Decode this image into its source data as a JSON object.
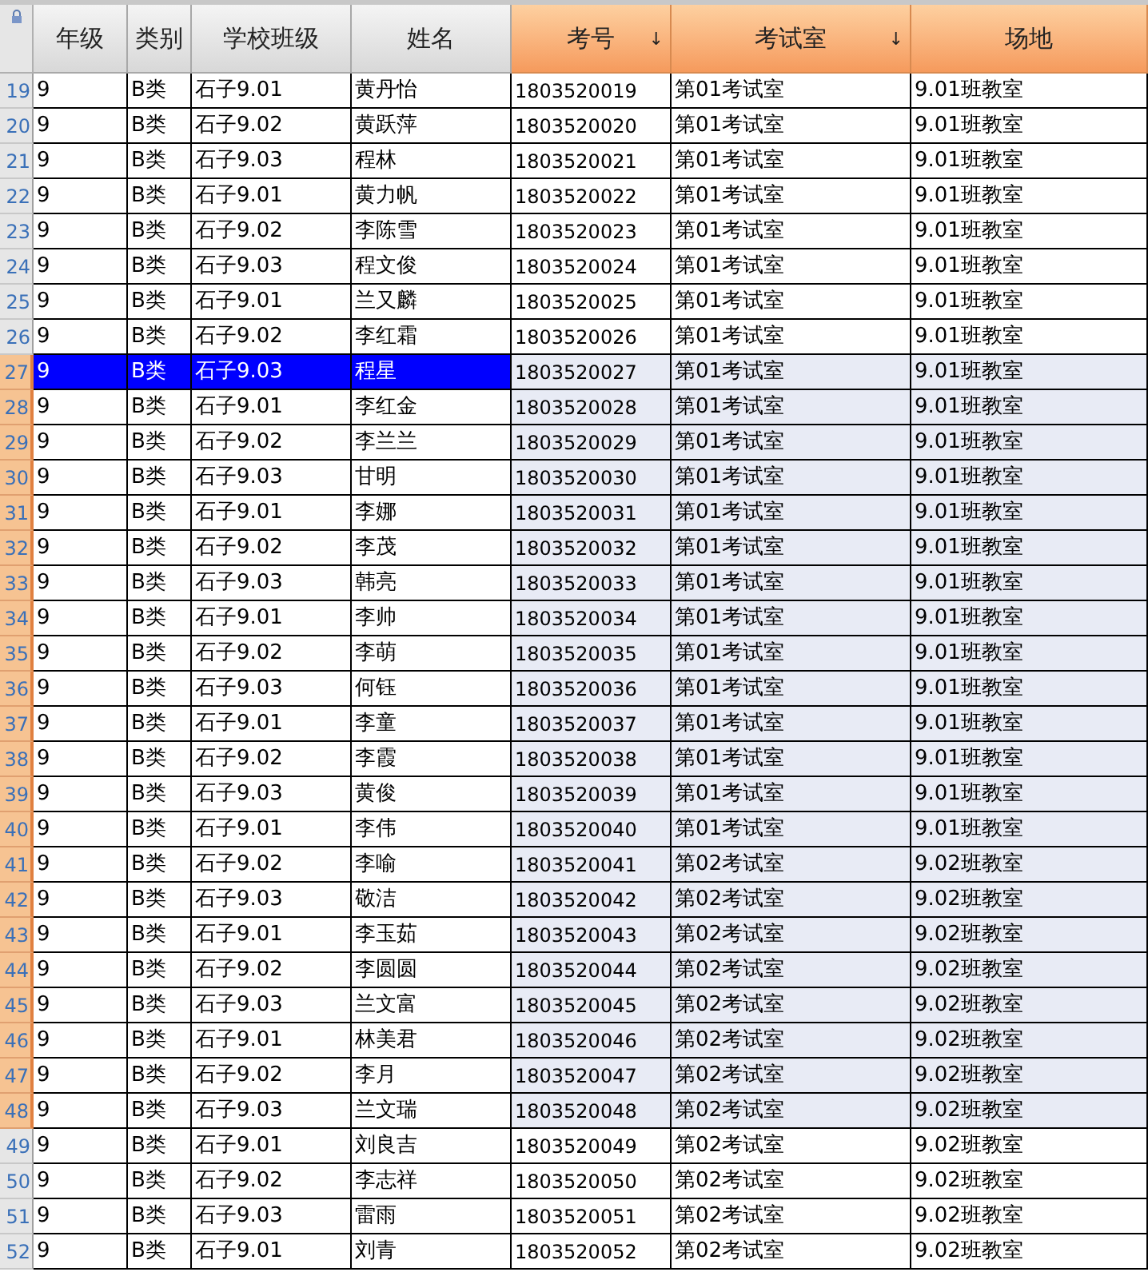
{
  "columns": [
    {
      "label": "年级",
      "selected": false
    },
    {
      "label": "类别",
      "selected": false
    },
    {
      "label": "学校班级",
      "selected": false
    },
    {
      "label": "姓名",
      "selected": false
    },
    {
      "label": "考号",
      "selected": true,
      "sort_mark": "↓"
    },
    {
      "label": "考试室",
      "selected": true,
      "sort_mark": "↓"
    },
    {
      "label": "场地",
      "selected": true
    }
  ],
  "rows": [
    {
      "number": "19",
      "cells": [
        "9",
        "B类",
        "石子9.01",
        "黄丹怡",
        "1803520019",
        "第01考试室",
        "9.01班教室"
      ],
      "selected": false,
      "current": false
    },
    {
      "number": "20",
      "cells": [
        "9",
        "B类",
        "石子9.02",
        "黄跃萍",
        "1803520020",
        "第01考试室",
        "9.01班教室"
      ],
      "selected": false,
      "current": false
    },
    {
      "number": "21",
      "cells": [
        "9",
        "B类",
        "石子9.03",
        "程林",
        "1803520021",
        "第01考试室",
        "9.01班教室"
      ],
      "selected": false,
      "current": false
    },
    {
      "number": "22",
      "cells": [
        "9",
        "B类",
        "石子9.01",
        "黄力帆",
        "1803520022",
        "第01考试室",
        "9.01班教室"
      ],
      "selected": false,
      "current": false
    },
    {
      "number": "23",
      "cells": [
        "9",
        "B类",
        "石子9.02",
        "李陈雪",
        "1803520023",
        "第01考试室",
        "9.01班教室"
      ],
      "selected": false,
      "current": false
    },
    {
      "number": "24",
      "cells": [
        "9",
        "B类",
        "石子9.03",
        "程文俊",
        "1803520024",
        "第01考试室",
        "9.01班教室"
      ],
      "selected": false,
      "current": false
    },
    {
      "number": "25",
      "cells": [
        "9",
        "B类",
        "石子9.01",
        "兰又麟",
        "1803520025",
        "第01考试室",
        "9.01班教室"
      ],
      "selected": false,
      "current": false
    },
    {
      "number": "26",
      "cells": [
        "9",
        "B类",
        "石子9.02",
        "李红霜",
        "1803520026",
        "第01考试室",
        "9.01班教室"
      ],
      "selected": false,
      "current": false
    },
    {
      "number": "27",
      "cells": [
        "9",
        "B类",
        "石子9.03",
        "程星",
        "1803520027",
        "第01考试室",
        "9.01班教室"
      ],
      "selected": true,
      "current": true
    },
    {
      "number": "28",
      "cells": [
        "9",
        "B类",
        "石子9.01",
        "李红金",
        "1803520028",
        "第01考试室",
        "9.01班教室"
      ],
      "selected": true,
      "current": false
    },
    {
      "number": "29",
      "cells": [
        "9",
        "B类",
        "石子9.02",
        "李兰兰",
        "1803520029",
        "第01考试室",
        "9.01班教室"
      ],
      "selected": true,
      "current": false
    },
    {
      "number": "30",
      "cells": [
        "9",
        "B类",
        "石子9.03",
        "甘明",
        "1803520030",
        "第01考试室",
        "9.01班教室"
      ],
      "selected": true,
      "current": false
    },
    {
      "number": "31",
      "cells": [
        "9",
        "B类",
        "石子9.01",
        "李娜",
        "1803520031",
        "第01考试室",
        "9.01班教室"
      ],
      "selected": true,
      "current": false
    },
    {
      "number": "32",
      "cells": [
        "9",
        "B类",
        "石子9.02",
        "李茂",
        "1803520032",
        "第01考试室",
        "9.01班教室"
      ],
      "selected": true,
      "current": false
    },
    {
      "number": "33",
      "cells": [
        "9",
        "B类",
        "石子9.03",
        "韩亮",
        "1803520033",
        "第01考试室",
        "9.01班教室"
      ],
      "selected": true,
      "current": false
    },
    {
      "number": "34",
      "cells": [
        "9",
        "B类",
        "石子9.01",
        "李帅",
        "1803520034",
        "第01考试室",
        "9.01班教室"
      ],
      "selected": true,
      "current": false
    },
    {
      "number": "35",
      "cells": [
        "9",
        "B类",
        "石子9.02",
        "李萌",
        "1803520035",
        "第01考试室",
        "9.01班教室"
      ],
      "selected": true,
      "current": false
    },
    {
      "number": "36",
      "cells": [
        "9",
        "B类",
        "石子9.03",
        "何钰",
        "1803520036",
        "第01考试室",
        "9.01班教室"
      ],
      "selected": true,
      "current": false
    },
    {
      "number": "37",
      "cells": [
        "9",
        "B类",
        "石子9.01",
        "李童",
        "1803520037",
        "第01考试室",
        "9.01班教室"
      ],
      "selected": true,
      "current": false
    },
    {
      "number": "38",
      "cells": [
        "9",
        "B类",
        "石子9.02",
        "李霞",
        "1803520038",
        "第01考试室",
        "9.01班教室"
      ],
      "selected": true,
      "current": false
    },
    {
      "number": "39",
      "cells": [
        "9",
        "B类",
        "石子9.03",
        "黄俊",
        "1803520039",
        "第01考试室",
        "9.01班教室"
      ],
      "selected": true,
      "current": false
    },
    {
      "number": "40",
      "cells": [
        "9",
        "B类",
        "石子9.01",
        "李伟",
        "1803520040",
        "第01考试室",
        "9.01班教室"
      ],
      "selected": true,
      "current": false
    },
    {
      "number": "41",
      "cells": [
        "9",
        "B类",
        "石子9.02",
        "李喻",
        "1803520041",
        "第02考试室",
        "9.02班教室"
      ],
      "selected": true,
      "current": false
    },
    {
      "number": "42",
      "cells": [
        "9",
        "B类",
        "石子9.03",
        "敬洁",
        "1803520042",
        "第02考试室",
        "9.02班教室"
      ],
      "selected": true,
      "current": false
    },
    {
      "number": "43",
      "cells": [
        "9",
        "B类",
        "石子9.01",
        "李玉茹",
        "1803520043",
        "第02考试室",
        "9.02班教室"
      ],
      "selected": true,
      "current": false
    },
    {
      "number": "44",
      "cells": [
        "9",
        "B类",
        "石子9.02",
        "李圆圆",
        "1803520044",
        "第02考试室",
        "9.02班教室"
      ],
      "selected": true,
      "current": false
    },
    {
      "number": "45",
      "cells": [
        "9",
        "B类",
        "石子9.03",
        "兰文富",
        "1803520045",
        "第02考试室",
        "9.02班教室"
      ],
      "selected": true,
      "current": false
    },
    {
      "number": "46",
      "cells": [
        "9",
        "B类",
        "石子9.01",
        "林美君",
        "1803520046",
        "第02考试室",
        "9.02班教室"
      ],
      "selected": true,
      "current": false
    },
    {
      "number": "47",
      "cells": [
        "9",
        "B类",
        "石子9.02",
        "李月",
        "1803520047",
        "第02考试室",
        "9.02班教室"
      ],
      "selected": true,
      "current": false
    },
    {
      "number": "48",
      "cells": [
        "9",
        "B类",
        "石子9.03",
        "兰文瑞",
        "1803520048",
        "第02考试室",
        "9.02班教室"
      ],
      "selected": true,
      "current": false
    },
    {
      "number": "49",
      "cells": [
        "9",
        "B类",
        "石子9.01",
        "刘良吉",
        "1803520049",
        "第02考试室",
        "9.02班教室"
      ],
      "selected": false,
      "current": false
    },
    {
      "number": "50",
      "cells": [
        "9",
        "B类",
        "石子9.02",
        "李志祥",
        "1803520050",
        "第02考试室",
        "9.02班教室"
      ],
      "selected": false,
      "current": false
    },
    {
      "number": "51",
      "cells": [
        "9",
        "B类",
        "石子9.03",
        "雷雨",
        "1803520051",
        "第02考试室",
        "9.02班教室"
      ],
      "selected": false,
      "current": false
    },
    {
      "number": "52",
      "cells": [
        "9",
        "B类",
        "石子9.01",
        "刘青",
        "1803520052",
        "第02考试室",
        "9.02班教室"
      ],
      "selected": false,
      "current": false
    }
  ]
}
